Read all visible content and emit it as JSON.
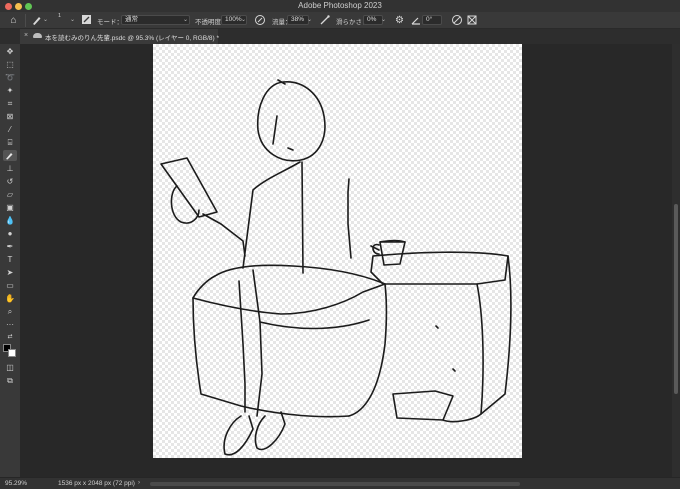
{
  "window": {
    "title": "Adobe Photoshop 2023"
  },
  "options_bar": {
    "mode_label": "モード：",
    "mode_value": "通常",
    "opacity_label": "不透明度：",
    "opacity_value": "100%",
    "flow_label": "流量：",
    "flow_value": "38%",
    "smoothing_label": "滑らかさ：",
    "smoothing_value": "0%",
    "angle_value": "0°",
    "brush_size": "1"
  },
  "tab": {
    "title": "本を読むみのりん先輩.psdc @ 95.3% (レイヤー 0, RGB/8) *"
  },
  "status": {
    "zoom": "95.29%",
    "doc_size": "1536 px x 2048 px (72 ppi)"
  },
  "colors": {
    "foreground": "#000000",
    "background": "#ffffff",
    "accent": "#2d8ceb"
  },
  "tools": [
    "move-icon",
    "marquee-icon",
    "lasso-icon",
    "magic-wand-icon",
    "crop-icon",
    "frame-icon",
    "eyedropper-icon",
    "healing-icon",
    "brush-icon",
    "stamp-icon",
    "history-brush-icon",
    "eraser-icon",
    "gradient-icon",
    "blur-icon",
    "dodge-icon",
    "pen-icon",
    "type-icon",
    "path-select-icon",
    "rectangle-icon",
    "hand-icon",
    "zoom-icon",
    "more-icon",
    "color-swatch-icon",
    "quick-mask-icon",
    "screen-mode-icon"
  ]
}
